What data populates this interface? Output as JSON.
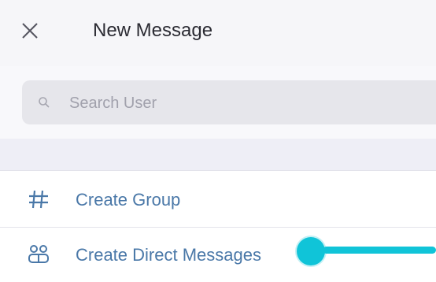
{
  "header": {
    "title": "New Message",
    "close_icon": "close-icon"
  },
  "search": {
    "placeholder": "Search User",
    "value": "",
    "icon": "search-icon"
  },
  "options": [
    {
      "label": "Create Group",
      "icon": "hash-icon"
    },
    {
      "label": "Create Direct Messages",
      "icon": "users-icon"
    }
  ],
  "colors": {
    "header_bg": "#f6f6f9",
    "search_bg": "#e6e6eb",
    "link_text": "#4a78a8",
    "cursor_accent": "#10c4d8"
  }
}
